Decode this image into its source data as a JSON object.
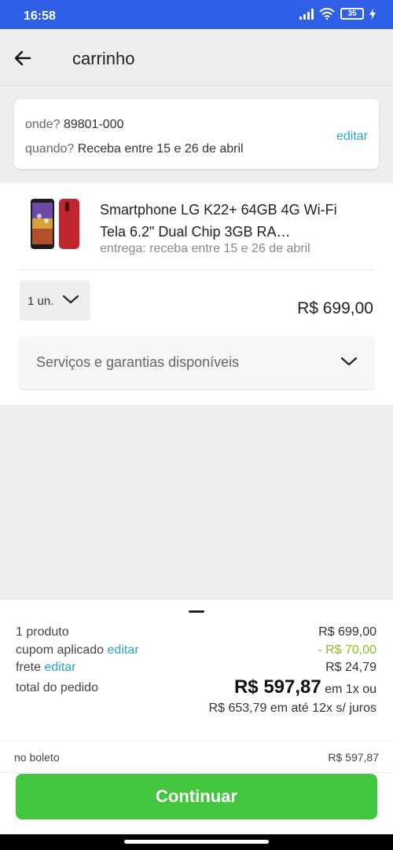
{
  "status_bar": {
    "time": "16:58",
    "battery": "35"
  },
  "header": {
    "title": "carrinho"
  },
  "delivery": {
    "where_label": "onde?",
    "where_value": "89801-000",
    "when_label": "quando?",
    "when_value": "Receba entre 15 e 26 de abril",
    "edit_label": "editar"
  },
  "product": {
    "name": "Smartphone LG K22+ 64GB 4G Wi-Fi Tela 6.2\" Dual Chip 3GB RA…",
    "delivery_text": "entrega: receba entre 15 e 26 de abril",
    "quantity": "1 un.",
    "price": "R$ 699,00",
    "services_label": "Serviços e garantias disponíveis"
  },
  "summary": {
    "products_label": "1 produto",
    "products_value": "R$ 699,00",
    "coupon_label": "cupom aplicado",
    "coupon_edit": "editar",
    "coupon_value": "- R$ 70,00",
    "shipping_label": "frete",
    "shipping_edit": "editar",
    "shipping_value": "R$ 24,79",
    "total_label": "total do pedido",
    "total_value": "R$ 597,87",
    "total_suffix": "em 1x ou",
    "installments": "R$ 653,79 em até 12x s/ juros",
    "boleto_label": "no boleto",
    "boleto_value": "R$ 597,87",
    "continue_label": "Continuar"
  },
  "colors": {
    "status_bar": "#2f5fe6",
    "link": "#2aa3c8",
    "discount": "#8cbf26",
    "primary_button": "#43c63d"
  },
  "icons": [
    "signal-icon",
    "wifi-icon",
    "battery-icon",
    "charging-icon",
    "back-arrow-icon",
    "chevron-down-icon"
  ]
}
